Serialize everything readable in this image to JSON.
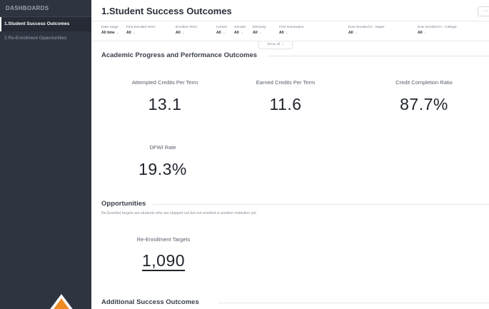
{
  "sidebar": {
    "header": "DASHBOARDS",
    "items": [
      {
        "label": "1.Student Success Outcomes",
        "active": true
      },
      {
        "label": "2.Re-Enrollment Opportunities",
        "active": false
      }
    ]
  },
  "page": {
    "title": "1.Student Success Outcomes",
    "more_label": "···"
  },
  "filters": [
    {
      "label": "Date range",
      "value": "All time"
    },
    {
      "label": "First Enrolled Term:",
      "value": "All"
    },
    {
      "label": "Enrolled Term:",
      "value": "All"
    },
    {
      "label": "Cohort:",
      "value": "All"
    },
    {
      "label": "Gender:",
      "value": "All"
    },
    {
      "label": "Ethnicity:",
      "value": "All"
    },
    {
      "label": "First Generation:",
      "value": "All"
    },
    {
      "label": "Ever Enrolled in - Major:",
      "value": "All"
    },
    {
      "label": "Ever Enrolled in - College:",
      "value": "All"
    }
  ],
  "show_all_label": "Show all",
  "sections": {
    "academic": {
      "title": "Academic Progress and Performance Outcomes",
      "kpis": [
        {
          "label": "Attempted Credits Per Term",
          "value": "13.1"
        },
        {
          "label": "Earned Credits Per Term",
          "value": "11.6"
        },
        {
          "label": "Credit Completion Ratio",
          "value": "87.7%"
        },
        {
          "label": "DFWI Rate",
          "value": "19.3%"
        }
      ]
    },
    "opportunities": {
      "title": "Opportunities",
      "subtitle": "Re-Enrolled targets are students who are stopped out but not enrolled in another institution yet.",
      "kpis": [
        {
          "label": "Re-Enrollment Targets",
          "value": "1,090"
        }
      ]
    },
    "additional": {
      "title": "Additional Success Outcomes"
    }
  },
  "colors": {
    "sidebar_bg": "#2f3441",
    "sidebar_active_bg": "#262a35",
    "warning_marker": "#f08a24"
  }
}
